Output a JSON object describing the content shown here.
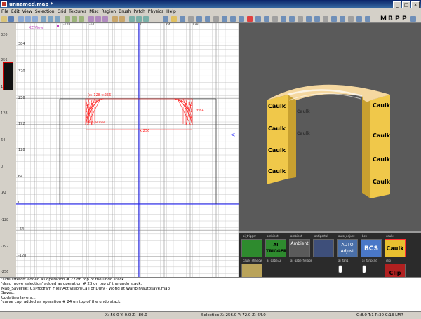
{
  "window": {
    "title": "unnamed.map *"
  },
  "menu": [
    "File",
    "Edit",
    "View",
    "Selection",
    "Grid",
    "Textures",
    "Misc",
    "Region",
    "Brush",
    "Patch",
    "Physics",
    "Help"
  ],
  "toolbar": {
    "letters": [
      "M",
      "B",
      "P",
      "P"
    ]
  },
  "grid": {
    "view_label": "XZ View",
    "left_labels": [
      "320",
      "256",
      "192",
      "128",
      "64",
      "0",
      "-64",
      "-128",
      "-192",
      "-256"
    ],
    "y_labels": [
      "384",
      "320",
      "256",
      "192",
      "128",
      "64",
      "0",
      "-64",
      "-128",
      "-192",
      "-256"
    ],
    "x_labels": [
      "-128",
      "-64",
      "0",
      "64",
      "128"
    ],
    "sel_label": "(x:-128 y:256)",
    "width_label": "x:256",
    "height_label": "z:64",
    "group_label": "func_group"
  },
  "camera": {
    "texture_text": "Caulk"
  },
  "textures": [
    {
      "name": "ai_trigger",
      "label": "AI\nTRIGGER",
      "color": "#2e8b2e"
    },
    {
      "name": "ambient",
      "label": "Ambient",
      "color": "#5a5a5a"
    },
    {
      "name": "antiportal",
      "label": "",
      "color": "#3e4f7a"
    },
    {
      "name": "auto_adjust",
      "label": "AUTO\nAdjust",
      "color": "#4a6fa8"
    },
    {
      "name": "bcs",
      "label": "BCS",
      "color": "#4a78c8"
    },
    {
      "name": "caulk",
      "label": "Caulk",
      "color": "#e8c030"
    },
    {
      "name": "caulk_shadow",
      "label": "",
      "color": "#b9a35a"
    },
    {
      "name": "clip",
      "label": "Clip",
      "color": "#b02020"
    }
  ],
  "tex_row2": [
    "ai_gabe32",
    "ai_gabe_foliage",
    "ai_gabe_water",
    "ai_fan1",
    "ai_fanpsnd"
  ],
  "console": [
    "'side stretch' added as operation # 22 on top of the undo stack.",
    "'drag move selection' added as operation # 23 on top of the undo stack.",
    "Map_SaveFile: C:\\Program Files\\Activision\\Call of Duty - World at War\\bin\\autosave.map",
    "Saved.",
    "Updating layers...",
    "'curve cap' added as operation # 24 on top of the undo stack."
  ],
  "status": {
    "coords": "X: 56.0  Y: 0.0  Z: -80.0",
    "selection": "Selection X: 256.0  Y: 72.0  Z: 64.0",
    "grid": "G:8.0 T:1 R:30 C:13 LMR"
  }
}
